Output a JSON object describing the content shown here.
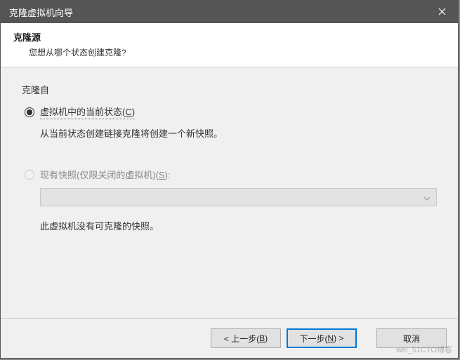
{
  "titlebar": {
    "title": "克隆虚拟机向导"
  },
  "header": {
    "title": "克隆源",
    "subtitle": "您想从哪个状态创建克隆?"
  },
  "content": {
    "section_label": "克隆自",
    "radios": {
      "current": {
        "label_pre": "虚拟机中的当前状态(",
        "accel": "C",
        "label_post": ")",
        "hint": "从当前状态创建链接克隆将创建一个新快照。"
      },
      "snapshot": {
        "label_pre": "现有快照(仅限关闭的虚拟机)(",
        "accel": "S",
        "label_post": "):",
        "message": "此虚拟机没有可克隆的快照。"
      }
    }
  },
  "footer": {
    "back_pre": "< 上一步(",
    "back_accel": "B",
    "back_post": ")",
    "next_pre": "下一步(",
    "next_accel": "N",
    "next_post": ") >",
    "cancel": "取消"
  },
  "watermark": "wei_51CTO博客"
}
